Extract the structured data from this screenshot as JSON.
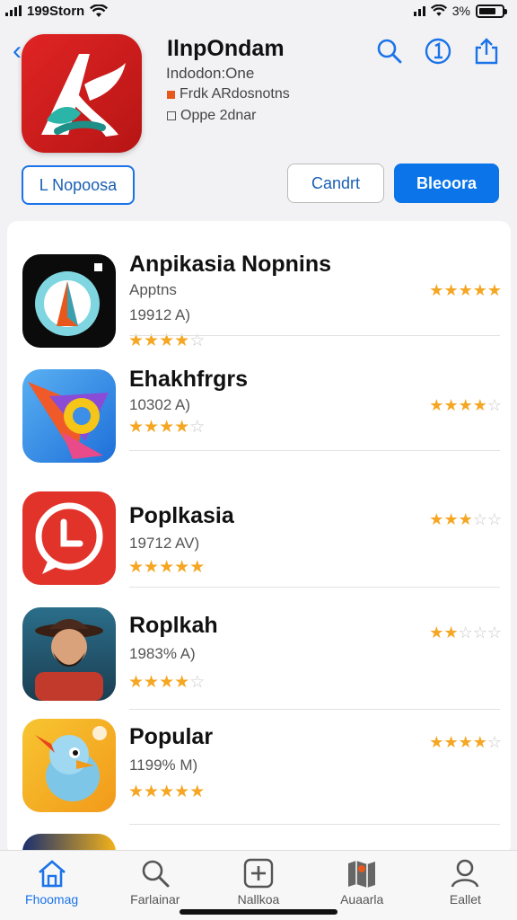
{
  "status": {
    "carrier": "199Storn",
    "battery": "3%"
  },
  "app": {
    "title": "IlnpOndam",
    "subtitle": "Indodon:One",
    "meta1": "Frdk ARdosnotns",
    "meta2": "Oppe 2dnar",
    "btn_left": "L Nopoosa",
    "btn_mid": "Candrt",
    "btn_right": "Bleoora"
  },
  "list": [
    {
      "name": "Anpikasia Nopnins",
      "category": "Apptns",
      "size": "19912 A)",
      "stars": 4,
      "right_stars": 4.5
    },
    {
      "name": "Ehakhfrgrs",
      "category": "",
      "size": "10302 A)",
      "stars": 4,
      "right_stars": 4
    },
    {
      "name": "Poplkasia",
      "category": "",
      "size": "19712 AV)",
      "stars": 5,
      "right_stars": 2.5
    },
    {
      "name": "Roplkah",
      "category": "",
      "size": "1983% A)",
      "stars": 4,
      "right_stars": 1.5
    },
    {
      "name": "Popular",
      "category": "",
      "size": "1199% M)",
      "stars": 4.5,
      "right_stars": 4
    }
  ],
  "tabs": [
    {
      "label": "Fhoomag",
      "icon": "home-icon",
      "active": true
    },
    {
      "label": "Farlainar",
      "icon": "search-icon",
      "active": false
    },
    {
      "label": "Nallkoa",
      "icon": "add-square-icon",
      "active": false
    },
    {
      "label": "Auaarla",
      "icon": "map-icon",
      "active": false
    },
    {
      "label": "Eallet",
      "icon": "person-icon",
      "active": false
    }
  ],
  "colors": {
    "accent": "#1a73e8",
    "star": "#f5a623",
    "brand_red": "#e02424"
  }
}
